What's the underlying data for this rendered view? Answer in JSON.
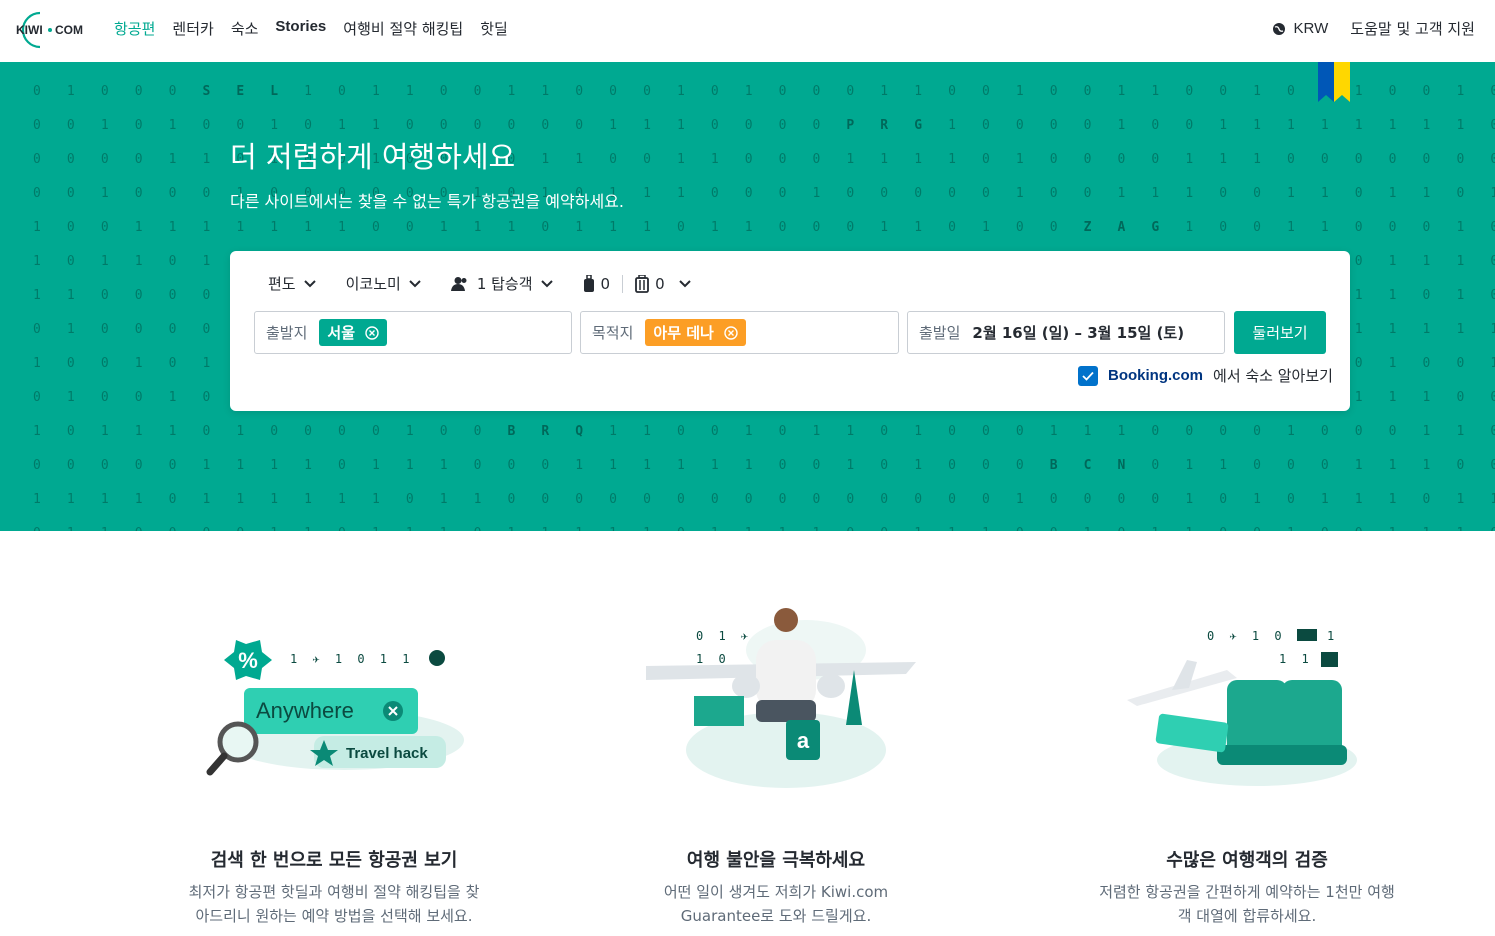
{
  "header": {
    "logo_text": "KIWI·COM",
    "nav": [
      {
        "label": "항공편",
        "active": true
      },
      {
        "label": "렌터카",
        "active": false
      },
      {
        "label": "숙소",
        "active": false
      },
      {
        "label": "Stories",
        "active": false
      },
      {
        "label": "여행비 절약 해킹팁",
        "active": false
      },
      {
        "label": "핫딜",
        "active": false
      }
    ],
    "currency": "KRW",
    "help": "도움말 및 고객 지원"
  },
  "hero": {
    "title": "더 저렴하게 여행하세요",
    "subtitle": "다른 사이트에서는 찾을 수 없는 특가 항공권을 예약하세요.",
    "background_color": "#00a991"
  },
  "search": {
    "trip_type": "편도",
    "cabin_class": "이코노미",
    "passengers": "1 탑승객",
    "cabin_bags": "0",
    "checked_bags": "0",
    "from": {
      "label": "출발지",
      "value": "서울"
    },
    "to": {
      "label": "목적지",
      "value": "아무 데나"
    },
    "dates": {
      "label": "출발일",
      "value": "2월 16일 (일) – 3월 15일 (토)"
    },
    "search_button": "둘러보기",
    "booking": {
      "brand": "Booking.com",
      "text": "에서 숙소 알아보기",
      "checked": true
    }
  },
  "features": [
    {
      "title": "검색 한 번으로 모든 항공권 보기",
      "text": "최저가 항공편 핫딜과 여행비 절약 해킹팁을 찾아드리니 원하는 예약 방법을 선택해 보세요.",
      "illus_anywhere": "Anywhere",
      "illus_hack": "Travel hack",
      "illus_digits": "1 ✈ 1 0 1 1"
    },
    {
      "title": "여행 불안을 극복하세요",
      "text": "어떤 일이 생겨도 저희가 Kiwi.com Guarantee로 도와 드릴게요.",
      "illus_digits_top": "0 1 ✈",
      "illus_digits_bottom": "1 0"
    },
    {
      "title": "수많은 여행객의 검증",
      "text": "저렴한 항공권을 간편하게 예약하는 1천만 여행객 대열에 합류하세요.",
      "illus_digits_top": "0 ✈ 1 0",
      "illus_digits_top2": "1",
      "illus_digits_bottom": "1 1"
    }
  ],
  "colors": {
    "accent": "#00a991",
    "orange": "#fc9e25",
    "text": "#252a31",
    "muted": "#5f6b78"
  }
}
